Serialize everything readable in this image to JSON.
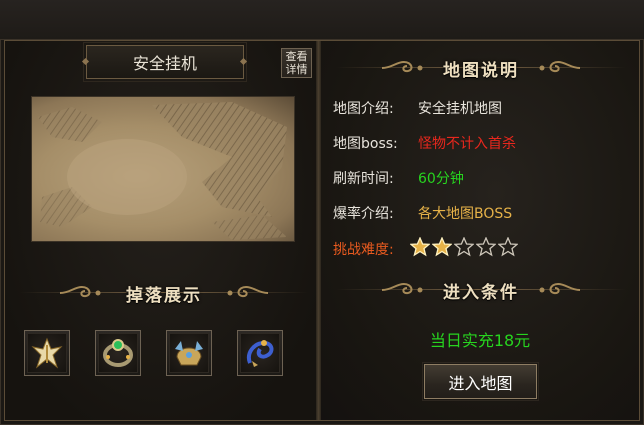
{
  "map_panel": {
    "title": "安全挂机",
    "detail_button": {
      "line1": "查看",
      "line2": "详情"
    }
  },
  "drops": {
    "header": "掉落展示",
    "items": [
      {
        "icon": "winged-cross-item-icon"
      },
      {
        "icon": "jeweled-ring-item-icon"
      },
      {
        "icon": "golden-helmet-item-icon"
      },
      {
        "icon": "blue-dragon-ornament-item-icon"
      }
    ]
  },
  "map_info": {
    "header": "地图说明",
    "rows": [
      {
        "label": "地图介绍:",
        "value": "安全挂机地图",
        "value_color": "#e8e4dc"
      },
      {
        "label": "地图boss:",
        "value": "怪物不计入首杀",
        "value_color": "#e8271d"
      },
      {
        "label": "刷新时间:",
        "value": "60分钟",
        "value_color": "#27d41f"
      },
      {
        "label": "爆率介绍:",
        "value": "各大地图BOSS",
        "value_color": "#e6b248"
      }
    ],
    "difficulty": {
      "label": "挑战难度:",
      "stars_filled": 2,
      "stars_total": 5
    }
  },
  "entry": {
    "header": "进入条件",
    "condition": "当日实充18元",
    "button_label": "进入地图"
  },
  "colors": {
    "accent_gold": "#e6b248",
    "danger_red": "#e8271d",
    "ok_green": "#27d41f"
  }
}
